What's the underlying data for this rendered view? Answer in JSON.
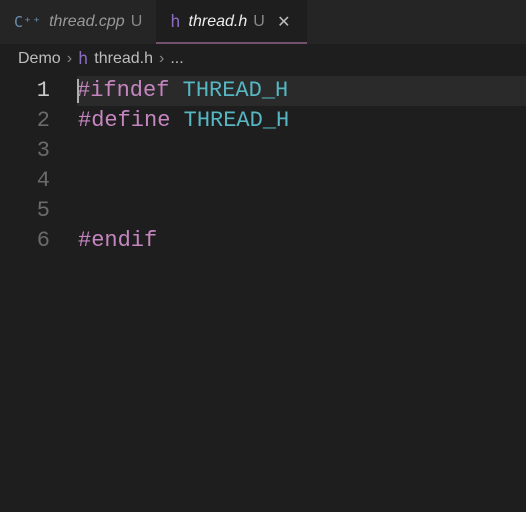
{
  "tabs": [
    {
      "filename": "thread.cpp",
      "modified": "U",
      "icon_name": "cpp-icon",
      "icon_glyph": "C⁺⁺"
    },
    {
      "filename": "thread.h",
      "modified": "U",
      "icon_name": "h-icon",
      "icon_glyph": "h"
    }
  ],
  "active_tab": 1,
  "close_glyph": "✕",
  "breadcrumbs": {
    "root": "Demo",
    "file": "thread.h",
    "file_icon_glyph": "h",
    "tail": "...",
    "sep": "›"
  },
  "editor": {
    "cursor_line": 1,
    "lines": [
      {
        "num": 1,
        "tokens": [
          {
            "cls": "tk-directive",
            "t": "#ifndef"
          },
          {
            "cls": "",
            "t": " "
          },
          {
            "cls": "tk-macro",
            "t": "THREAD_H"
          }
        ]
      },
      {
        "num": 2,
        "tokens": [
          {
            "cls": "tk-directive",
            "t": "#define"
          },
          {
            "cls": "",
            "t": " "
          },
          {
            "cls": "tk-macro",
            "t": "THREAD_H"
          }
        ]
      },
      {
        "num": 3,
        "tokens": []
      },
      {
        "num": 4,
        "tokens": []
      },
      {
        "num": 5,
        "tokens": []
      },
      {
        "num": 6,
        "tokens": [
          {
            "cls": "tk-directive",
            "t": "#endif"
          }
        ]
      }
    ]
  }
}
